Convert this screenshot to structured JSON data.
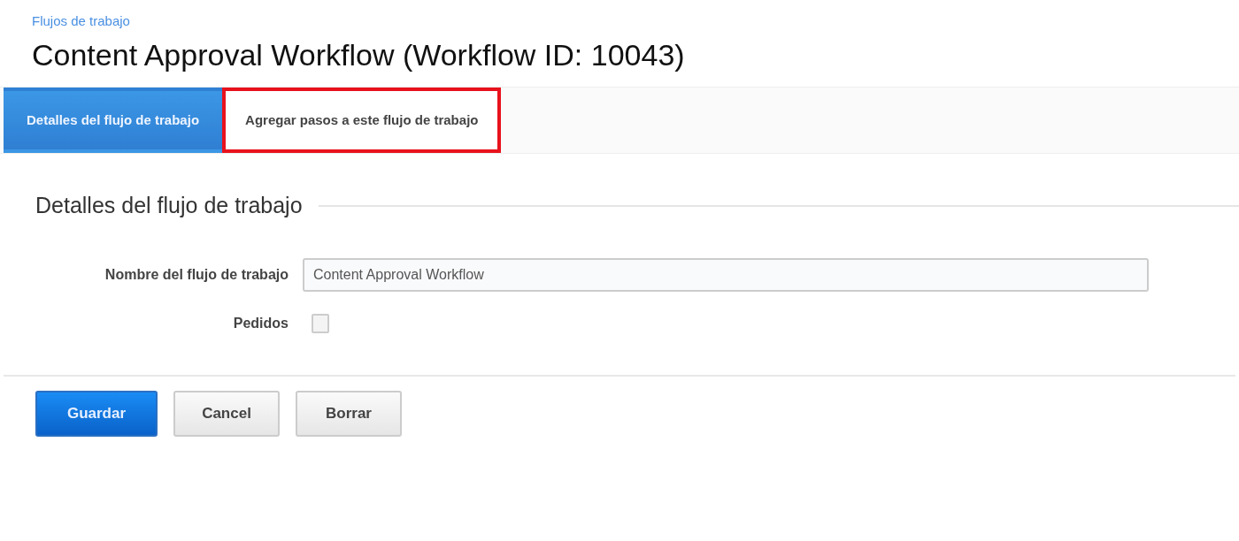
{
  "breadcrumb": "Flujos de trabajo",
  "title": "Content Approval Workflow (Workflow ID: 10043)",
  "tabs": [
    {
      "label": "Detalles del flujo de trabajo",
      "selected": true,
      "highlighted": false
    },
    {
      "label": "Agregar pasos a este flujo de trabajo",
      "selected": false,
      "highlighted": true
    }
  ],
  "section": {
    "heading": "Detalles del flujo de trabajo",
    "fields": [
      {
        "kind": "text",
        "label": "Nombre del flujo de trabajo",
        "value": "Content Approval Workflow"
      },
      {
        "kind": "checkbox",
        "label": "Pedidos",
        "checked": false
      }
    ]
  },
  "buttons": [
    {
      "label": "Guardar",
      "kind": "primary"
    },
    {
      "label": "Cancel",
      "kind": "default"
    },
    {
      "label": "Borrar",
      "kind": "default"
    }
  ]
}
